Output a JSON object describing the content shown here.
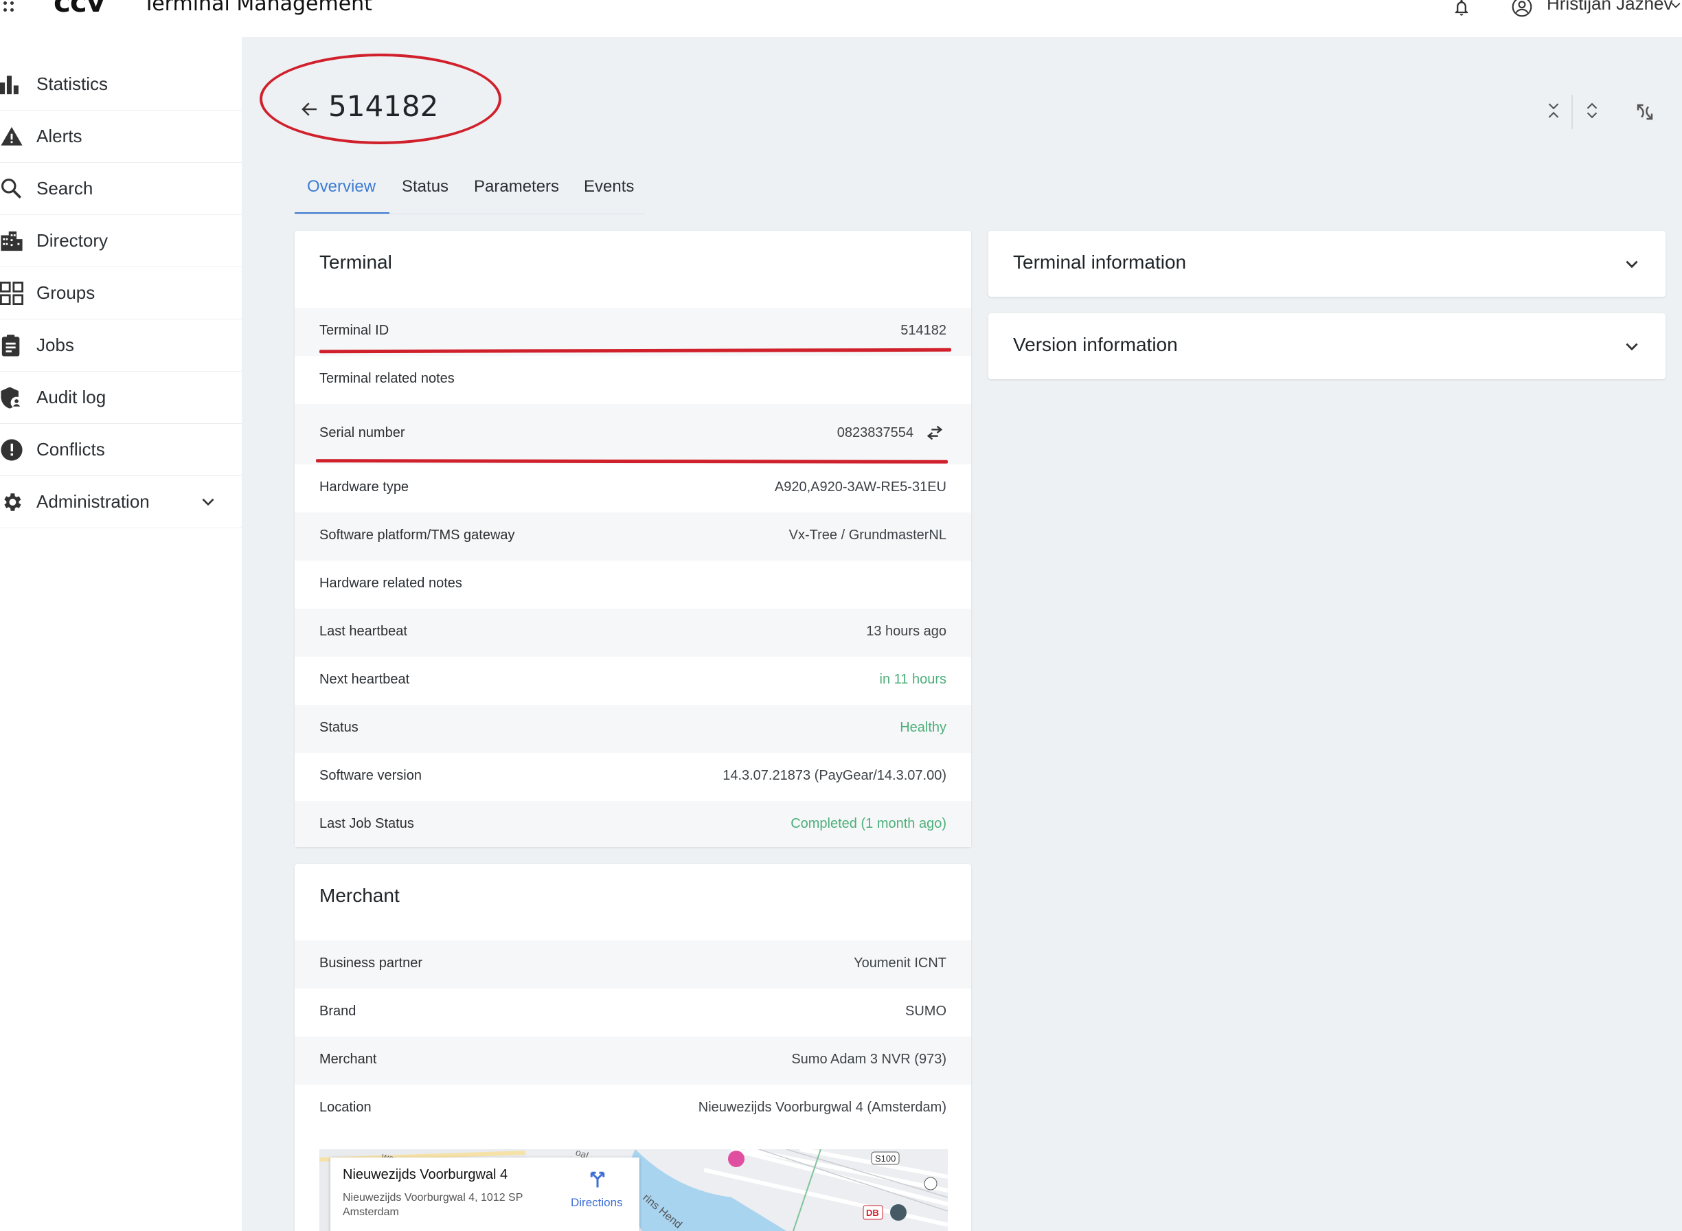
{
  "app": {
    "logo": "ccv",
    "title": "Terminal Management"
  },
  "user": {
    "name": "Hristijan Jazhev"
  },
  "sidebar": {
    "items": [
      {
        "label": "Statistics",
        "icon": "bar-chart-icon"
      },
      {
        "label": "Alerts",
        "icon": "warning-icon"
      },
      {
        "label": "Search",
        "icon": "search-icon"
      },
      {
        "label": "Directory",
        "icon": "building-icon"
      },
      {
        "label": "Groups",
        "icon": "grid-icon"
      },
      {
        "label": "Jobs",
        "icon": "clipboard-icon"
      },
      {
        "label": "Audit log",
        "icon": "shield-user-icon"
      },
      {
        "label": "Conflicts",
        "icon": "exclamation-circle-icon"
      },
      {
        "label": "Administration",
        "icon": "gear-icon"
      }
    ]
  },
  "page": {
    "title": "514182"
  },
  "tabs": [
    {
      "label": "Overview",
      "active": true
    },
    {
      "label": "Status",
      "active": false
    },
    {
      "label": "Parameters",
      "active": false
    },
    {
      "label": "Events",
      "active": false
    }
  ],
  "terminal_card": {
    "title": "Terminal",
    "rows": [
      {
        "label": "Terminal ID",
        "value": "514182"
      },
      {
        "label": "Terminal related notes",
        "value": ""
      },
      {
        "label": "Serial number",
        "value": "0823837554"
      },
      {
        "label": "Hardware type",
        "value": "A920,A920-3AW-RE5-31EU"
      },
      {
        "label": "Software platform/TMS gateway",
        "value": "Vx-Tree / GrundmasterNL"
      },
      {
        "label": "Hardware related notes",
        "value": ""
      },
      {
        "label": "Last heartbeat",
        "value": "13 hours ago"
      },
      {
        "label": "Next heartbeat",
        "value": "in 11 hours"
      },
      {
        "label": "Status",
        "value": "Healthy"
      },
      {
        "label": "Software version",
        "value": "14.3.07.21873 (PayGear/14.3.07.00)"
      },
      {
        "label": "Last Job Status",
        "value": "Completed (1 month ago)"
      }
    ]
  },
  "merchant_card": {
    "title": "Merchant",
    "rows": [
      {
        "label": "Business partner",
        "value": "Youmenit ICNT"
      },
      {
        "label": "Brand",
        "value": "SUMO"
      },
      {
        "label": "Merchant",
        "value": "Sumo Adam 3 NVR (973)"
      },
      {
        "label": "Location",
        "value": "Nieuwezijds Voorburgwal 4 (Amsterdam)"
      }
    ]
  },
  "accordions": [
    {
      "title": "Terminal information"
    },
    {
      "title": "Version information"
    }
  ],
  "map": {
    "place_title": "Nieuwezijds Voorburgwal 4",
    "address": "Nieuwezijds Voorburgwal 4, 1012 SP Amsterdam",
    "directions_label": "Directions",
    "labels": {
      "s100": "S100",
      "db": "DB",
      "street": "rins Hend",
      "top_left": "wer",
      "top_mid": "oal"
    }
  },
  "colors": {
    "accent": "#3d7cd2",
    "positive": "#4caf7a",
    "annotation": "#d0202b",
    "background": "#eef1f4"
  }
}
